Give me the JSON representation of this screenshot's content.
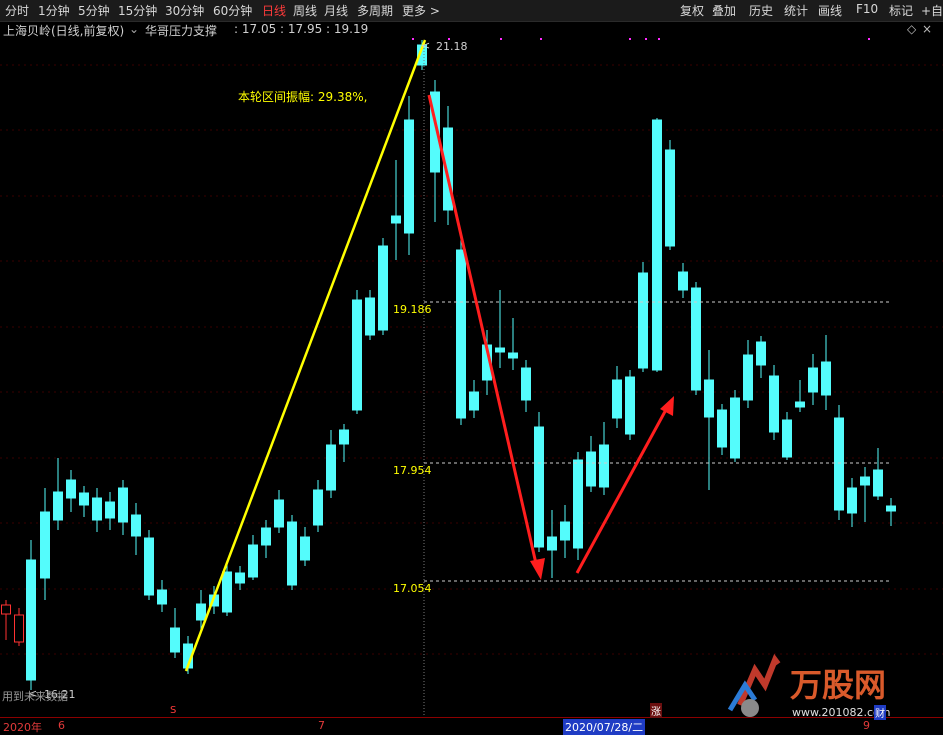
{
  "toolbar": {
    "periods": [
      "分时",
      "1分钟",
      "5分钟",
      "15分钟",
      "30分钟",
      "60分钟",
      "日线",
      "周线",
      "月线",
      "多周期",
      "更多 >"
    ],
    "active_period": "日线",
    "actions": [
      "复权",
      "叠加",
      "历史",
      "统计",
      "画线",
      "F10",
      "标记",
      "+自"
    ]
  },
  "info": {
    "stock_title": "上海贝岭(日线,前复权)",
    "indicator_name": "华哥压力支撑",
    "indicator_values": ": 17.05 : 17.95 : 19.19"
  },
  "chart": {
    "peak_label": "21.18",
    "low_label": "16.21",
    "amplitude_text": "本轮区间振幅: 29.38%,",
    "levels": [
      {
        "label": "19.186",
        "price": 19.186
      },
      {
        "label": "17.954",
        "price": 17.954
      },
      {
        "label": "17.054",
        "price": 17.054
      }
    ],
    "future_hint": "用到未来数据",
    "colors": {
      "up": "#ff3232",
      "down": "#54fcfc",
      "yellow_line": "#ffff00",
      "arrow": "#ff1e1e",
      "level_line": "#cccccc",
      "level_text": "#ffff00"
    }
  },
  "bottom_axis": {
    "year": "2020年",
    "month_6": "6",
    "month_7": "7",
    "crosshair_date": "2020/07/28/二",
    "marker_s": "S",
    "marker_zhang": "涨",
    "marker_cai": "财",
    "marker_9": "9"
  },
  "watermark": {
    "brand": "万股网",
    "url": "www.201082.com"
  }
}
